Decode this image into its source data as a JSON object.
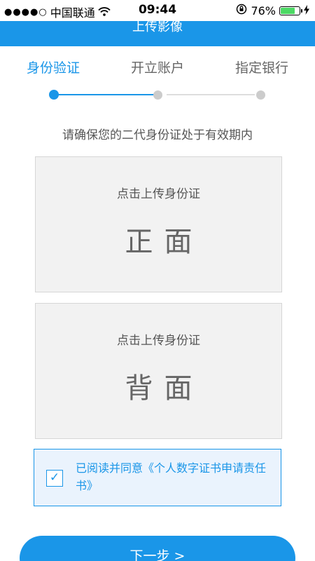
{
  "status_bar": {
    "signal": "●●●●○",
    "carrier": "中国联通",
    "wifi_icon": "wifi-icon",
    "time": "09:44",
    "lock_icon": "rotation-lock-icon",
    "battery_percent": "76%",
    "battery_level": 0.76,
    "charging_icon": "charging-bolt-icon"
  },
  "nav": {
    "title": "上传影像"
  },
  "steps": {
    "items": [
      "身份验证",
      "开立账户",
      "指定银行"
    ],
    "active_index": 0
  },
  "notice": "请确保您的二代身份证处于有效期内",
  "upload_front": {
    "hint": "点击上传身份证",
    "side": "正面"
  },
  "upload_back": {
    "hint": "点击上传身份证",
    "side": "背面"
  },
  "agreement": {
    "checked": true,
    "checkmark": "✓",
    "text": "已阅读并同意《个人数字证书申请责任书》"
  },
  "next_button": {
    "label": "下一步 >"
  },
  "colors": {
    "accent": "#1a96e8",
    "inactive_dot": "#cccccc",
    "card_bg": "#f2f2f2"
  }
}
